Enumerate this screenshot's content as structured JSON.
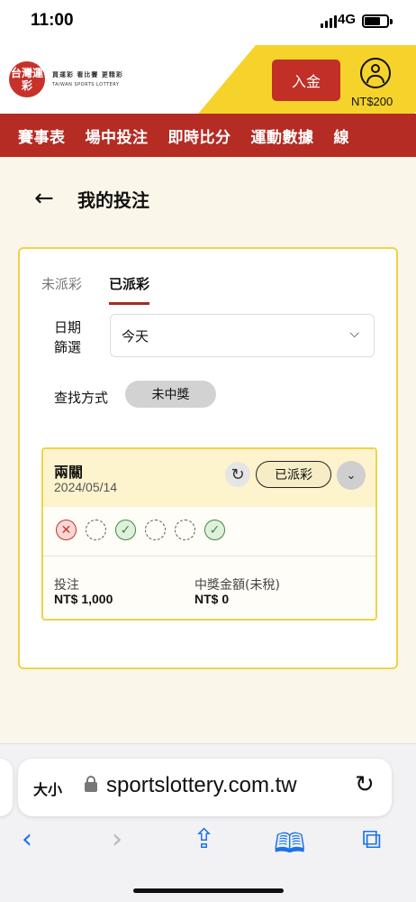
{
  "status_bar": {
    "time": "11:00",
    "network": "4G"
  },
  "header": {
    "logo_text": "台灣運彩",
    "slogan": "買運彩 看比賽 更精彩",
    "logo_en": "TAIWAN SPORTS LOTTERY",
    "deposit_label": "入金",
    "balance": "NT$200",
    "accent_color": "#b42c24",
    "highlight_color": "#f6d32b"
  },
  "nav": {
    "items": [
      "賽事表",
      "場中投注",
      "即時比分",
      "運動數據",
      "線"
    ]
  },
  "page": {
    "back_icon": "←",
    "title": "我的投注"
  },
  "tabs": [
    {
      "label": "未派彩",
      "active": false
    },
    {
      "label": "已派彩",
      "active": true
    }
  ],
  "filter": {
    "date_label": "日期篩選",
    "date_value": "今天",
    "find_label": "查找方式",
    "find_chip": "未中獎"
  },
  "bet": {
    "type": "兩關",
    "date": "2024/05/14",
    "status": "已派彩",
    "legs": [
      "lose",
      "pending",
      "win",
      "pending",
      "pending",
      "win"
    ],
    "stake_label": "投注",
    "stake_value": "NT$ 1,000",
    "prize_label": "中獎金額(未稅)",
    "prize_value": "NT$ 0"
  },
  "browser": {
    "text_size_label": "大小",
    "url": "sportslottery.com.tw",
    "icons": [
      "back-icon",
      "forward-icon",
      "share-icon",
      "bookmarks-icon",
      "tabs-icon"
    ]
  }
}
